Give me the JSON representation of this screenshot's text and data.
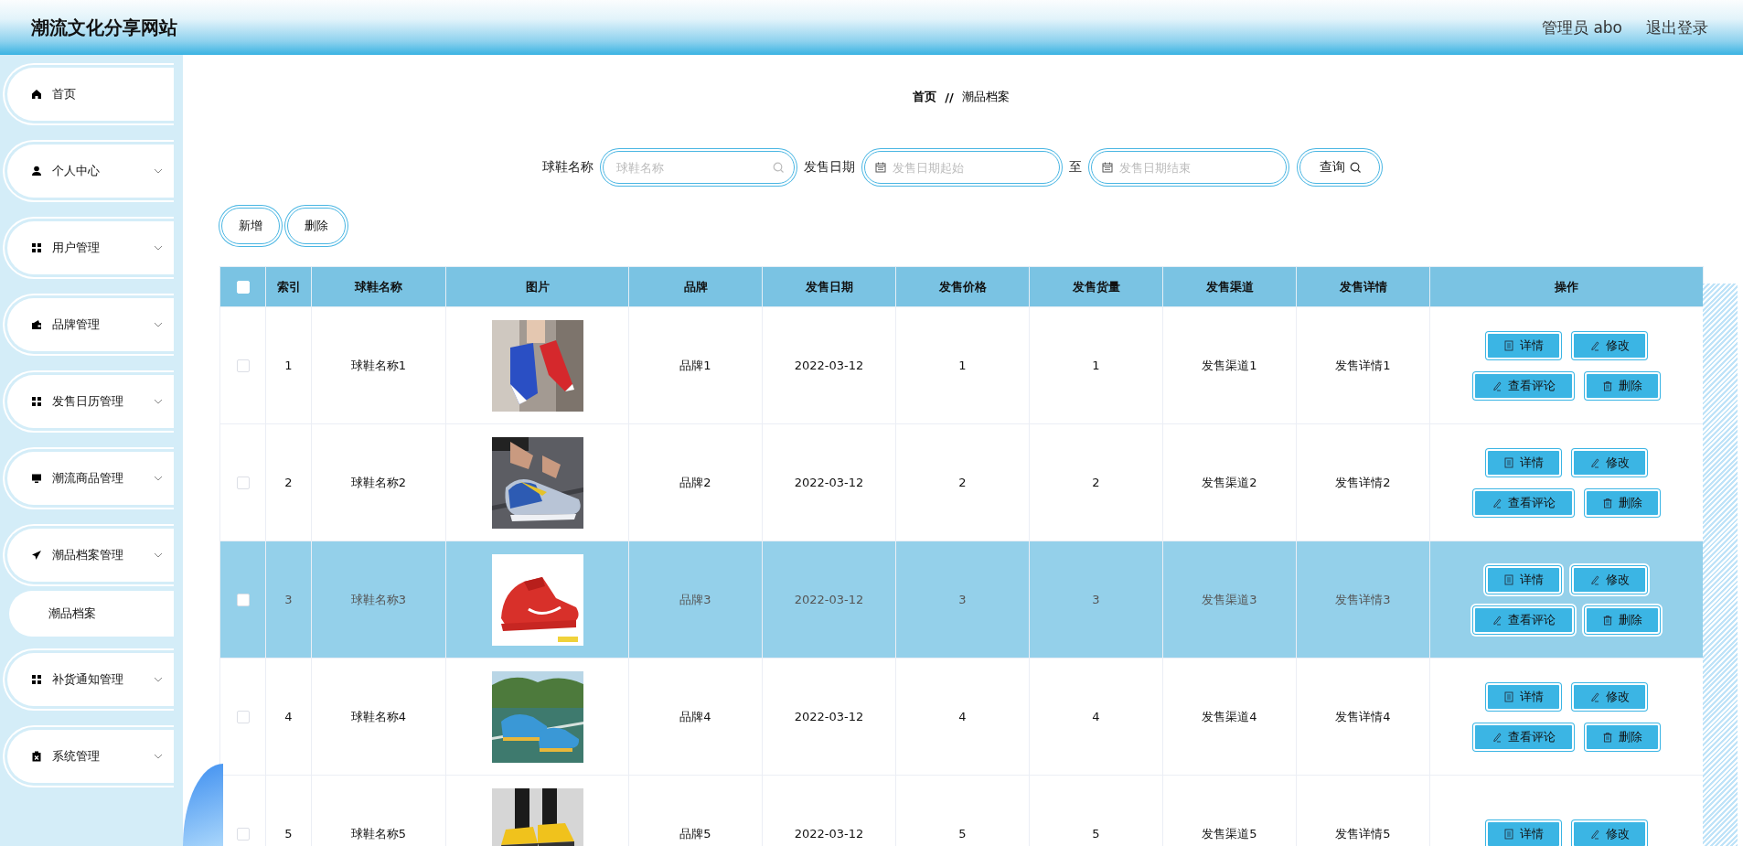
{
  "header": {
    "title": "潮流文化分享网站",
    "user": "管理员 abo",
    "logout": "退出登录"
  },
  "sidebar": {
    "items": [
      {
        "label": "首页",
        "kind": "link"
      },
      {
        "label": "个人中心",
        "kind": "menu"
      },
      {
        "label": "用户管理",
        "kind": "menu"
      },
      {
        "label": "品牌管理",
        "kind": "menu"
      },
      {
        "label": "发售日历管理",
        "kind": "menu"
      },
      {
        "label": "潮流商品管理",
        "kind": "menu"
      },
      {
        "label": "潮品档案管理",
        "kind": "menu",
        "children": [
          {
            "label": "潮品档案"
          }
        ]
      },
      {
        "label": "补货通知管理",
        "kind": "menu"
      },
      {
        "label": "系统管理",
        "kind": "menu"
      }
    ]
  },
  "breadcrumb": {
    "items": [
      "首页",
      "潮品档案"
    ],
    "separator": "//"
  },
  "search": {
    "fields": [
      {
        "label": "球鞋名称",
        "placeholder": "球鞋名称",
        "kind": "text"
      },
      {
        "label": "发售日期",
        "placeholder": "发售日期起始",
        "kind": "date"
      },
      {
        "label": "至",
        "placeholder": "发售日期结束",
        "kind": "date"
      }
    ],
    "button": "查询"
  },
  "actions": [
    "新增",
    "删除"
  ],
  "table": {
    "select_all": {
      "checked": false
    },
    "columns": [
      "索引",
      "球鞋名称",
      "图片",
      "品牌",
      "发售日期",
      "发售价格",
      "发售货量",
      "发售渠道",
      "发售详情",
      "操作"
    ],
    "rows": [
      {
        "checked": false,
        "selected": false,
        "index": "1",
        "name": "球鞋名称1",
        "brand": "品牌1",
        "date": "2022-03-12",
        "price": "1",
        "quantity": "1",
        "channel": "发售渠道1",
        "details": "发售详情1",
        "actions": [
          {
            "label": "详情",
            "kind": "detail"
          },
          {
            "label": "修改",
            "kind": "edit"
          },
          {
            "label": "查看评论",
            "kind": "comments"
          },
          {
            "label": "删除",
            "kind": "delete"
          }
        ]
      },
      {
        "checked": false,
        "selected": false,
        "index": "2",
        "name": "球鞋名称2",
        "brand": "品牌2",
        "date": "2022-03-12",
        "price": "2",
        "quantity": "2",
        "channel": "发售渠道2",
        "details": "发售详情2",
        "actions": [
          {
            "label": "详情",
            "kind": "detail"
          },
          {
            "label": "修改",
            "kind": "edit"
          },
          {
            "label": "查看评论",
            "kind": "comments"
          },
          {
            "label": "删除",
            "kind": "delete"
          }
        ]
      },
      {
        "checked": false,
        "selected": true,
        "index": "3",
        "name": "球鞋名称3",
        "brand": "品牌3",
        "date": "2022-03-12",
        "price": "3",
        "quantity": "3",
        "channel": "发售渠道3",
        "details": "发售详情3",
        "actions": [
          {
            "label": "详情",
            "kind": "detail"
          },
          {
            "label": "修改",
            "kind": "edit"
          },
          {
            "label": "查看评论",
            "kind": "comments"
          },
          {
            "label": "删除",
            "kind": "delete"
          }
        ]
      },
      {
        "checked": false,
        "selected": false,
        "index": "4",
        "name": "球鞋名称4",
        "brand": "品牌4",
        "date": "2022-03-12",
        "price": "4",
        "quantity": "4",
        "channel": "发售渠道4",
        "details": "发售详情4",
        "actions": [
          {
            "label": "详情",
            "kind": "detail"
          },
          {
            "label": "修改",
            "kind": "edit"
          },
          {
            "label": "查看评论",
            "kind": "comments"
          },
          {
            "label": "删除",
            "kind": "delete"
          }
        ]
      },
      {
        "checked": false,
        "selected": false,
        "index": "5",
        "name": "球鞋名称5",
        "brand": "品牌5",
        "date": "2022-03-12",
        "price": "5",
        "quantity": "5",
        "channel": "发售渠道5",
        "details": "发售详情5",
        "actions": [
          {
            "label": "详情",
            "kind": "detail"
          },
          {
            "label": "修改",
            "kind": "edit"
          }
        ]
      }
    ]
  }
}
